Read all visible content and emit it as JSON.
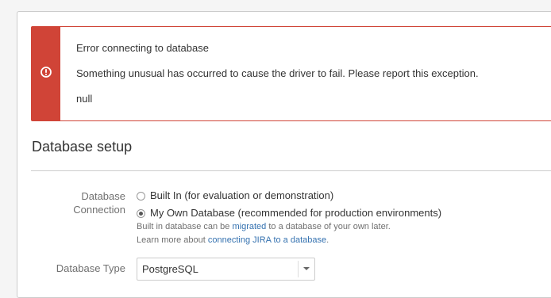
{
  "error": {
    "title": "Error connecting to database",
    "message": "Something unusual has occurred to cause the driver to fail. Please report this exception.",
    "detail": "null",
    "icon": "exclamation-circle-icon",
    "color": "#d04437"
  },
  "section": {
    "title": "Database setup"
  },
  "connection": {
    "label_line1": "Database",
    "label_line2": "Connection",
    "options": [
      {
        "label": "Built In (for evaluation or demonstration)",
        "checked": false
      },
      {
        "label": "My Own Database (recommended for production environments)",
        "checked": true
      }
    ],
    "help1_prefix": "Built in database can be ",
    "help1_link": "migrated",
    "help1_suffix": " to a database of your own later.",
    "help2_prefix": "Learn more about ",
    "help2_link": "connecting JIRA to a database",
    "help2_suffix": "."
  },
  "database_type": {
    "label": "Database Type",
    "selected": "PostgreSQL"
  }
}
